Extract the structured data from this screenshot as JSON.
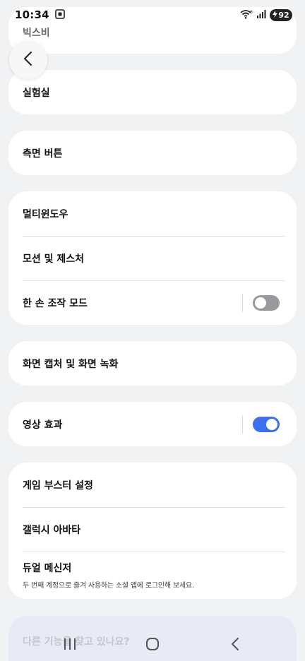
{
  "status_bar": {
    "time": "10:34",
    "battery": "92"
  },
  "back_button": {
    "icon": "chevron-left-icon"
  },
  "cards": {
    "bixby": {
      "label": "빅스비"
    },
    "lab": {
      "label": "실험실"
    },
    "side_button": {
      "label": "측면 버튼"
    },
    "group1": {
      "multi_window": "멀티윈도우",
      "motion_gesture": "모션 및 제스처",
      "one_hand_mode": "한 손 조작 모드",
      "one_hand_mode_on": false
    },
    "screen_capture": {
      "label": "화면 캡처 및 화면 녹화"
    },
    "video_effects": {
      "label": "영상 효과",
      "on": true
    },
    "group2": {
      "game_booster": "게임 부스터 설정",
      "galaxy_avatar": "갤럭시 아바타",
      "dual_messenger": "듀얼 메신저",
      "dual_messenger_desc": "두 번째 계정으로 즐겨 사용하는 소셜 앱에 로그인해 보세요."
    },
    "looking_for": {
      "label": "다른 기능을 찾고 있나요?"
    }
  },
  "colors": {
    "background": "#f1f2f4",
    "card": "#ffffff",
    "toggle_on": "#3e6ff0",
    "toggle_off": "#9a9a9e"
  }
}
